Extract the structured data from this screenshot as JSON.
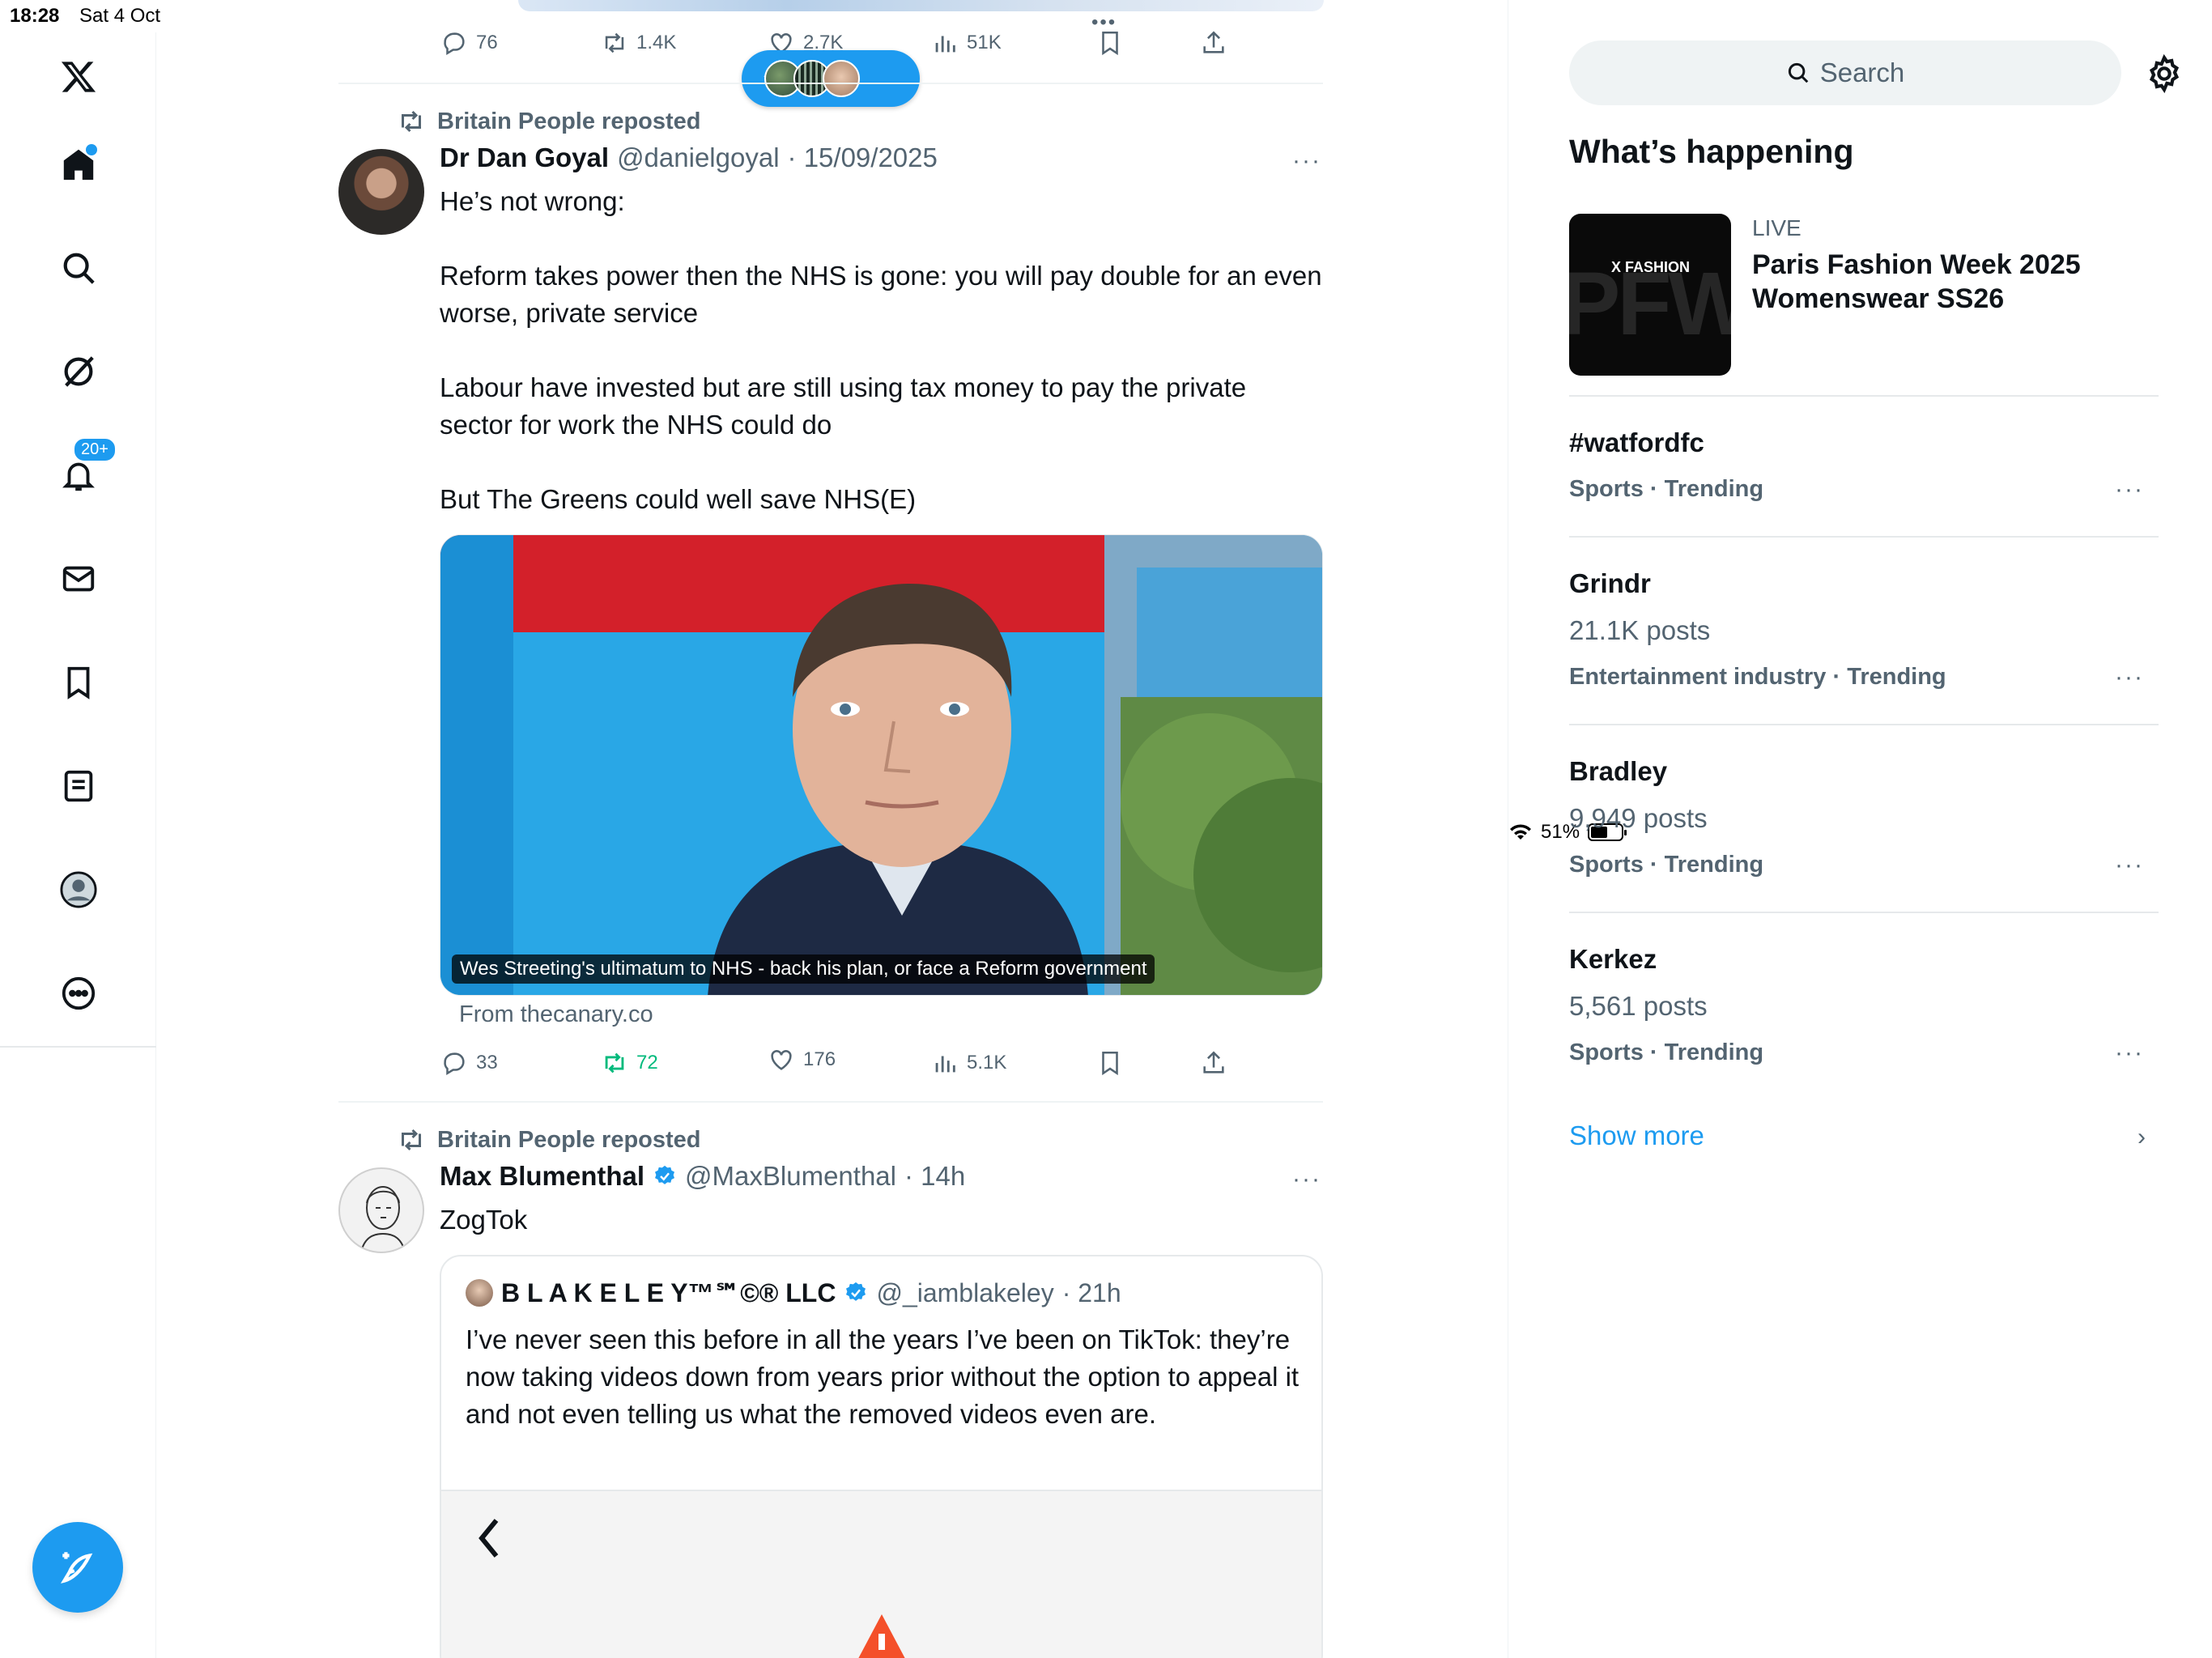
{
  "status": {
    "time": "18:28",
    "date": "Sat 4 Oct",
    "battery": "51%"
  },
  "nav": {
    "notifications_badge": "20+"
  },
  "top_tweet_actions": {
    "replies": "76",
    "reposts": "1.4K",
    "likes": "2.7K",
    "views": "51K"
  },
  "tweet1": {
    "reposted_by": "Britain People reposted",
    "name": "Dr Dan Goyal",
    "handle": "@danielgoyal",
    "date": "· 15/09/2025",
    "text": "He’s not wrong:\n\nReform takes power then the NHS is gone: you will pay double for an even worse, private service\n\nLabour have invested but are still using tax money to pay the private sector for work the NHS could do\n\nBut The Greens could well save NHS(E)",
    "media_caption": "Wes Streeting's ultimatum to NHS - back his plan, or face a Reform government",
    "source": "From thecanary.co",
    "replies": "33",
    "reposts": "72",
    "likes": "176",
    "views": "5.1K"
  },
  "tweet2": {
    "reposted_by": "Britain People reposted",
    "name": "Max Blumenthal",
    "handle": "@MaxBlumenthal",
    "date": "· 14h",
    "text": "ZogTok",
    "quote": {
      "name": "B L A K E L E Y™℠©® LLC",
      "handle": "@_iamblakeley",
      "date": "· 21h",
      "text": "I’ve never seen this before in all the years I’ve been on TikTok: they’re now taking videos down from years prior without the option to appeal it and not even telling us what the removed videos even are."
    }
  },
  "sidebar": {
    "search_placeholder": "Search",
    "title": "What’s happening",
    "featured": {
      "label": "LIVE",
      "title": "Paris Fashion Week 2025 Womenswear SS26",
      "image_text": "X FASHION",
      "image_bg_text": "PFW"
    },
    "trends": [
      {
        "name": "#watfordfc",
        "posts": "",
        "category": "Sports · Trending"
      },
      {
        "name": "Grindr",
        "posts": "21.1K posts",
        "category": "Entertainment industry · Trending"
      },
      {
        "name": "Bradley",
        "posts": "9,949 posts",
        "category": "Sports · Trending"
      },
      {
        "name": "Kerkez",
        "posts": "5,561 posts",
        "category": "Sports · Trending"
      }
    ],
    "show_more": "Show more"
  },
  "colors": {
    "accent": "#1d9bf0",
    "text_secondary": "#536471",
    "repost_active": "#00ba7c"
  }
}
